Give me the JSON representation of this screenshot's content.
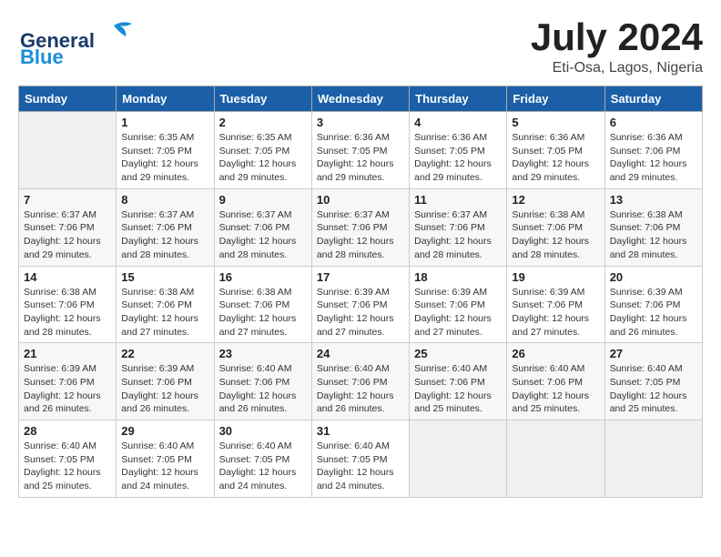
{
  "logo": {
    "text_general": "General",
    "text_blue": "Blue"
  },
  "title": {
    "month_year": "July 2024",
    "location": "Eti-Osa, Lagos, Nigeria"
  },
  "days_of_week": [
    "Sunday",
    "Monday",
    "Tuesday",
    "Wednesday",
    "Thursday",
    "Friday",
    "Saturday"
  ],
  "weeks": [
    [
      {
        "day": "",
        "sunrise": "",
        "sunset": "",
        "daylight": ""
      },
      {
        "day": "1",
        "sunrise": "Sunrise: 6:35 AM",
        "sunset": "Sunset: 7:05 PM",
        "daylight": "Daylight: 12 hours and 29 minutes."
      },
      {
        "day": "2",
        "sunrise": "Sunrise: 6:35 AM",
        "sunset": "Sunset: 7:05 PM",
        "daylight": "Daylight: 12 hours and 29 minutes."
      },
      {
        "day": "3",
        "sunrise": "Sunrise: 6:36 AM",
        "sunset": "Sunset: 7:05 PM",
        "daylight": "Daylight: 12 hours and 29 minutes."
      },
      {
        "day": "4",
        "sunrise": "Sunrise: 6:36 AM",
        "sunset": "Sunset: 7:05 PM",
        "daylight": "Daylight: 12 hours and 29 minutes."
      },
      {
        "day": "5",
        "sunrise": "Sunrise: 6:36 AM",
        "sunset": "Sunset: 7:05 PM",
        "daylight": "Daylight: 12 hours and 29 minutes."
      },
      {
        "day": "6",
        "sunrise": "Sunrise: 6:36 AM",
        "sunset": "Sunset: 7:06 PM",
        "daylight": "Daylight: 12 hours and 29 minutes."
      }
    ],
    [
      {
        "day": "7",
        "sunrise": "Sunrise: 6:37 AM",
        "sunset": "Sunset: 7:06 PM",
        "daylight": "Daylight: 12 hours and 29 minutes."
      },
      {
        "day": "8",
        "sunrise": "Sunrise: 6:37 AM",
        "sunset": "Sunset: 7:06 PM",
        "daylight": "Daylight: 12 hours and 28 minutes."
      },
      {
        "day": "9",
        "sunrise": "Sunrise: 6:37 AM",
        "sunset": "Sunset: 7:06 PM",
        "daylight": "Daylight: 12 hours and 28 minutes."
      },
      {
        "day": "10",
        "sunrise": "Sunrise: 6:37 AM",
        "sunset": "Sunset: 7:06 PM",
        "daylight": "Daylight: 12 hours and 28 minutes."
      },
      {
        "day": "11",
        "sunrise": "Sunrise: 6:37 AM",
        "sunset": "Sunset: 7:06 PM",
        "daylight": "Daylight: 12 hours and 28 minutes."
      },
      {
        "day": "12",
        "sunrise": "Sunrise: 6:38 AM",
        "sunset": "Sunset: 7:06 PM",
        "daylight": "Daylight: 12 hours and 28 minutes."
      },
      {
        "day": "13",
        "sunrise": "Sunrise: 6:38 AM",
        "sunset": "Sunset: 7:06 PM",
        "daylight": "Daylight: 12 hours and 28 minutes."
      }
    ],
    [
      {
        "day": "14",
        "sunrise": "Sunrise: 6:38 AM",
        "sunset": "Sunset: 7:06 PM",
        "daylight": "Daylight: 12 hours and 28 minutes."
      },
      {
        "day": "15",
        "sunrise": "Sunrise: 6:38 AM",
        "sunset": "Sunset: 7:06 PM",
        "daylight": "Daylight: 12 hours and 27 minutes."
      },
      {
        "day": "16",
        "sunrise": "Sunrise: 6:38 AM",
        "sunset": "Sunset: 7:06 PM",
        "daylight": "Daylight: 12 hours and 27 minutes."
      },
      {
        "day": "17",
        "sunrise": "Sunrise: 6:39 AM",
        "sunset": "Sunset: 7:06 PM",
        "daylight": "Daylight: 12 hours and 27 minutes."
      },
      {
        "day": "18",
        "sunrise": "Sunrise: 6:39 AM",
        "sunset": "Sunset: 7:06 PM",
        "daylight": "Daylight: 12 hours and 27 minutes."
      },
      {
        "day": "19",
        "sunrise": "Sunrise: 6:39 AM",
        "sunset": "Sunset: 7:06 PM",
        "daylight": "Daylight: 12 hours and 27 minutes."
      },
      {
        "day": "20",
        "sunrise": "Sunrise: 6:39 AM",
        "sunset": "Sunset: 7:06 PM",
        "daylight": "Daylight: 12 hours and 26 minutes."
      }
    ],
    [
      {
        "day": "21",
        "sunrise": "Sunrise: 6:39 AM",
        "sunset": "Sunset: 7:06 PM",
        "daylight": "Daylight: 12 hours and 26 minutes."
      },
      {
        "day": "22",
        "sunrise": "Sunrise: 6:39 AM",
        "sunset": "Sunset: 7:06 PM",
        "daylight": "Daylight: 12 hours and 26 minutes."
      },
      {
        "day": "23",
        "sunrise": "Sunrise: 6:40 AM",
        "sunset": "Sunset: 7:06 PM",
        "daylight": "Daylight: 12 hours and 26 minutes."
      },
      {
        "day": "24",
        "sunrise": "Sunrise: 6:40 AM",
        "sunset": "Sunset: 7:06 PM",
        "daylight": "Daylight: 12 hours and 26 minutes."
      },
      {
        "day": "25",
        "sunrise": "Sunrise: 6:40 AM",
        "sunset": "Sunset: 7:06 PM",
        "daylight": "Daylight: 12 hours and 25 minutes."
      },
      {
        "day": "26",
        "sunrise": "Sunrise: 6:40 AM",
        "sunset": "Sunset: 7:06 PM",
        "daylight": "Daylight: 12 hours and 25 minutes."
      },
      {
        "day": "27",
        "sunrise": "Sunrise: 6:40 AM",
        "sunset": "Sunset: 7:05 PM",
        "daylight": "Daylight: 12 hours and 25 minutes."
      }
    ],
    [
      {
        "day": "28",
        "sunrise": "Sunrise: 6:40 AM",
        "sunset": "Sunset: 7:05 PM",
        "daylight": "Daylight: 12 hours and 25 minutes."
      },
      {
        "day": "29",
        "sunrise": "Sunrise: 6:40 AM",
        "sunset": "Sunset: 7:05 PM",
        "daylight": "Daylight: 12 hours and 24 minutes."
      },
      {
        "day": "30",
        "sunrise": "Sunrise: 6:40 AM",
        "sunset": "Sunset: 7:05 PM",
        "daylight": "Daylight: 12 hours and 24 minutes."
      },
      {
        "day": "31",
        "sunrise": "Sunrise: 6:40 AM",
        "sunset": "Sunset: 7:05 PM",
        "daylight": "Daylight: 12 hours and 24 minutes."
      },
      {
        "day": "",
        "sunrise": "",
        "sunset": "",
        "daylight": ""
      },
      {
        "day": "",
        "sunrise": "",
        "sunset": "",
        "daylight": ""
      },
      {
        "day": "",
        "sunrise": "",
        "sunset": "",
        "daylight": ""
      }
    ]
  ]
}
